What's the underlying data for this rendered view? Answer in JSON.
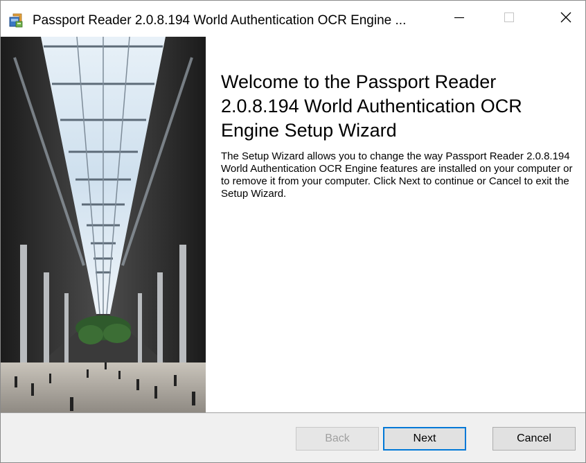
{
  "window": {
    "title": "Passport Reader 2.0.8.194 World Authentication OCR Engine ...",
    "icons": {
      "app": "installer-package-icon",
      "minimize": "minimize-icon",
      "maximize": "maximize-icon",
      "close": "close-icon"
    }
  },
  "content": {
    "heading": "Welcome to the Passport Reader 2.0.8.194 World Authentication OCR Engine Setup Wizard",
    "description": "The Setup Wizard allows you to change the way Passport Reader 2.0.8.194 World Authentication OCR Engine features are installed on your computer or to remove it from your computer. Click Next to continue or Cancel to exit the Setup Wizard."
  },
  "buttons": {
    "back": "Back",
    "next": "Next",
    "cancel": "Cancel"
  },
  "colors": {
    "accent": "#0078d7",
    "bottom_bar": "#f0f0f0",
    "disabled_text": "#a0a0a0"
  }
}
